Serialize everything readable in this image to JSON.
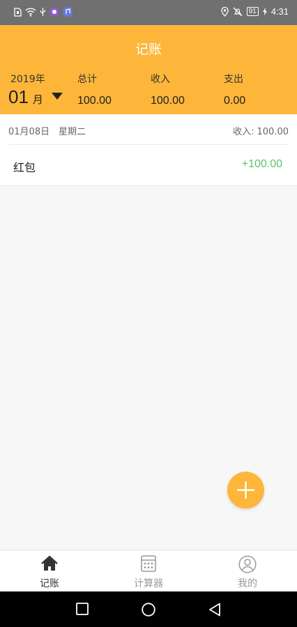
{
  "status_bar": {
    "time": "4:31",
    "battery": "91",
    "icons": [
      "sim-icon",
      "wifi-icon",
      "usb-icon",
      "app-notification-icon",
      "music-icon",
      "location-icon",
      "mute-icon",
      "battery-icon"
    ]
  },
  "header": {
    "title": "记账",
    "year": "2019年",
    "month": "01",
    "month_unit": "月",
    "stats": {
      "total_label": "总计",
      "total_value": "100.00",
      "income_label": "收入",
      "income_value": "100.00",
      "expense_label": "支出",
      "expense_value": "0.00"
    }
  },
  "days": [
    {
      "date": "01月08日",
      "weekday": "星期二",
      "income_summary": "收入: 100.00",
      "records": [
        {
          "name": "红包",
          "amount": "+100.00"
        }
      ]
    }
  ],
  "bottom_nav": {
    "tabs": [
      {
        "label": "记账",
        "icon": "home-icon",
        "active": true
      },
      {
        "label": "计算器",
        "icon": "calculator-icon",
        "active": false
      },
      {
        "label": "我的",
        "icon": "profile-icon",
        "active": false
      }
    ]
  },
  "colors": {
    "accent": "#fdb63a",
    "income_green": "#5cc46a",
    "status_bar": "#707070"
  }
}
